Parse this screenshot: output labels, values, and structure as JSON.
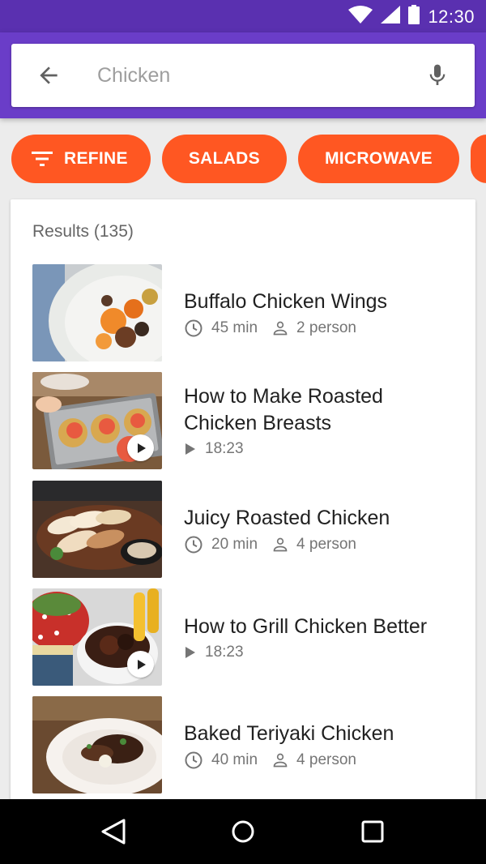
{
  "status_bar": {
    "time": "12:30",
    "icons": [
      "wifi-icon",
      "signal-icon",
      "battery-icon"
    ]
  },
  "search": {
    "placeholder": "Chicken",
    "back_icon": "arrow-back-icon",
    "mic_icon": "mic-icon"
  },
  "chips": [
    {
      "label": "REFINE",
      "icon": "filter-icon"
    },
    {
      "label": "SALADS"
    },
    {
      "label": "MICROWAVE"
    }
  ],
  "results": {
    "title": "Results (135)",
    "items": [
      {
        "title": "Buffalo Chicken Wings",
        "time": "45 min",
        "servings": "2 person",
        "video": false
      },
      {
        "title": "How to Make Roasted Chicken Breasts",
        "duration": "18:23",
        "video": true
      },
      {
        "title": "Juicy Roasted Chicken",
        "time": "20 min",
        "servings": "4 person",
        "video": false
      },
      {
        "title": "How to Grill Chicken Better",
        "duration": "18:23",
        "video": true
      },
      {
        "title": "Baked Teriyaki Chicken",
        "time": "40 min",
        "servings": "4 person",
        "video": false
      }
    ]
  },
  "colors": {
    "status_bar": "#5a30b0",
    "app_bar": "#6a3dc8",
    "chip": "#ff5722",
    "nav_bar": "#000000"
  },
  "nav": {
    "icons": [
      "back-triangle-icon",
      "home-circle-icon",
      "recents-square-icon"
    ]
  }
}
